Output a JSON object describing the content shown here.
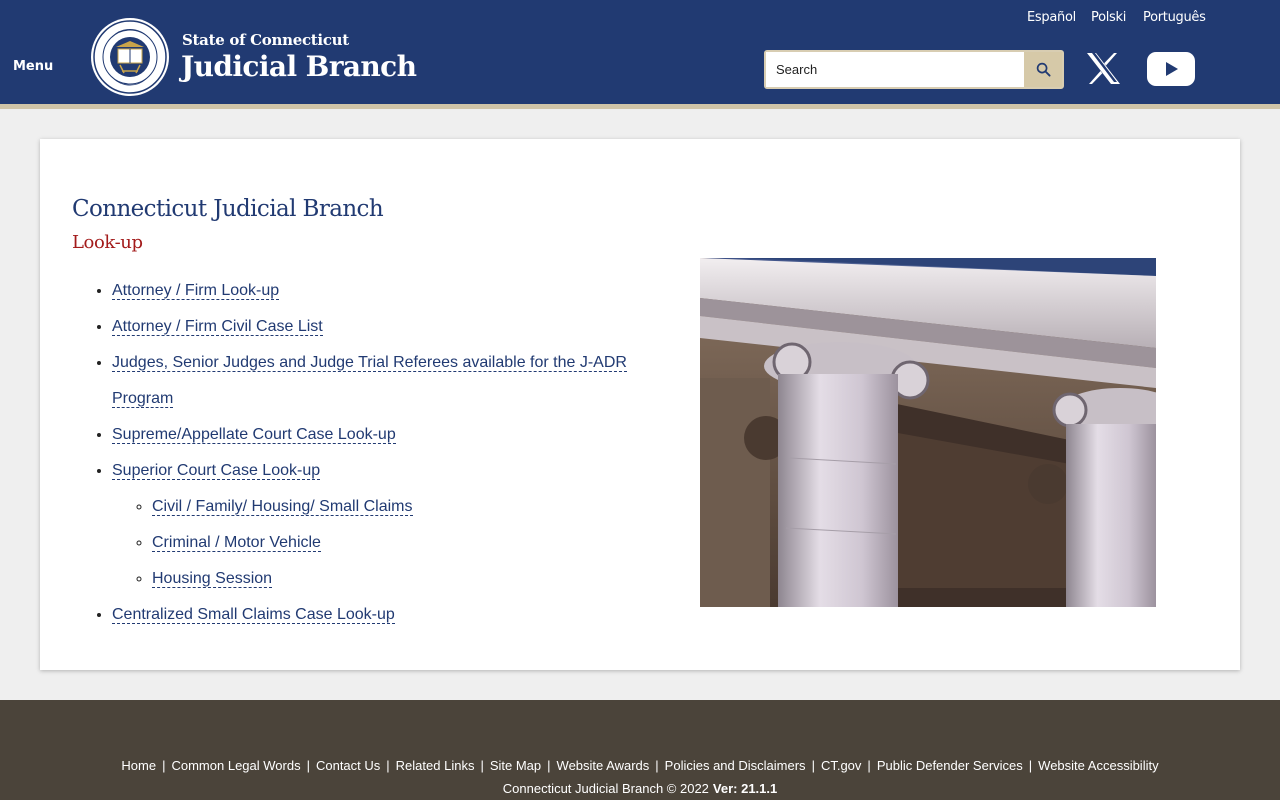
{
  "header": {
    "menu_label": "Menu",
    "brand_small": "State of Connecticut",
    "brand_large": "Judicial Branch",
    "seal_icon": "state-seal-icon",
    "languages": [
      "Español",
      "Polski",
      "Português"
    ],
    "search_placeholder": "Search",
    "search_icon": "search-icon",
    "social": [
      "x-twitter-icon",
      "youtube-icon"
    ],
    "colors": {
      "primary": "#213a72",
      "accent": "#d6c9a8"
    }
  },
  "main": {
    "title": "Connecticut Judicial Branch",
    "subtitle": "Look-up",
    "links": [
      {
        "label": "Attorney / Firm Look-up"
      },
      {
        "label": "Attorney / Firm Civil Case List"
      },
      {
        "label": "Judges, Senior Judges and Judge Trial Referees available for the J-ADR Program"
      },
      {
        "label": "Supreme/Appellate Court Case Look-up"
      },
      {
        "label": "Superior Court Case Look-up",
        "children": [
          {
            "label": "Civil / Family/ Housing/ Small Claims"
          },
          {
            "label": "Criminal / Motor Vehicle"
          },
          {
            "label": "Housing Session"
          }
        ]
      },
      {
        "label": "Centralized Small Claims Case Look-up"
      }
    ],
    "subtitle_color": "#a31b1b"
  },
  "footer": {
    "links": [
      "Home",
      "Common Legal Words",
      "Contact Us",
      "Related Links",
      "Site Map",
      "Website Awards",
      "Policies and Disclaimers",
      "CT.gov",
      "Public Defender Services",
      "Website Accessibility"
    ],
    "copyright": "Connecticut Judicial Branch © 2022",
    "version": "Ver: 21.1.1",
    "background": "#4b443a"
  }
}
